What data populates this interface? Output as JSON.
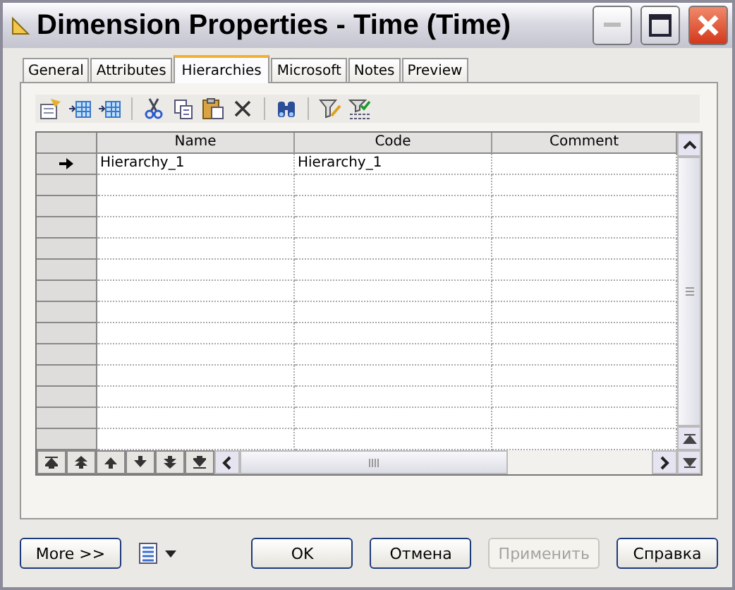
{
  "window": {
    "title": "Dimension Properties - Time (Time)"
  },
  "tabs": [
    {
      "label": "General",
      "selected": false
    },
    {
      "label": "Attributes",
      "selected": false
    },
    {
      "label": "Hierarchies",
      "selected": true
    },
    {
      "label": "Microsoft",
      "selected": false
    },
    {
      "label": "Notes",
      "selected": false
    },
    {
      "label": "Preview",
      "selected": false
    }
  ],
  "grid": {
    "columns": [
      "Name",
      "Code",
      "Comment"
    ],
    "rows": [
      {
        "cells": [
          "Hierarchy_1",
          "Hierarchy_1"
        ],
        "current": true
      }
    ]
  },
  "buttons": [
    {
      "label": "More >>",
      "disabled": false
    },
    {
      "label": "OK",
      "disabled": false
    },
    {
      "label": "Отмена",
      "disabled": false
    },
    {
      "label": "Применить",
      "disabled": true
    },
    {
      "label": "Справка",
      "disabled": false
    }
  ]
}
